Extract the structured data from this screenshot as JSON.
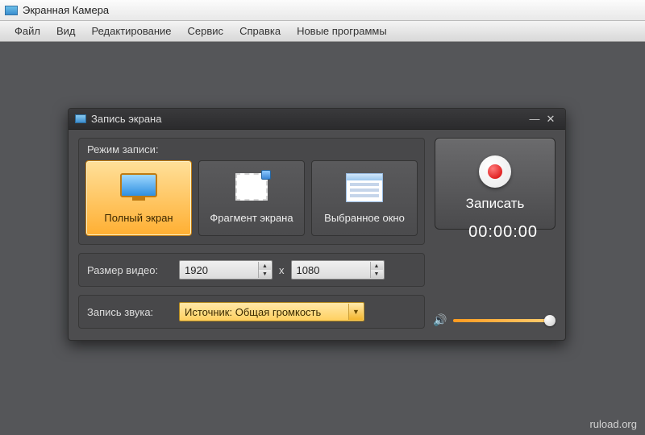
{
  "app": {
    "title": "Экранная Камера"
  },
  "menubar": {
    "items": [
      "Файл",
      "Вид",
      "Редактирование",
      "Сервис",
      "Справка",
      "Новые программы"
    ]
  },
  "dialog": {
    "title": "Запись экрана",
    "mode_legend": "Режим записи:",
    "modes": [
      {
        "label": "Полный экран"
      },
      {
        "label": "Фрагмент экрана"
      },
      {
        "label": "Выбранное окно"
      }
    ],
    "record_label": "Записать",
    "timer": "00:00:00",
    "size_label": "Размер видео:",
    "size_width": "1920",
    "size_height": "1080",
    "size_sep": "x",
    "audio_label": "Запись звука:",
    "audio_source": "Источник: Общая громкость"
  },
  "watermark": "ruload.org"
}
